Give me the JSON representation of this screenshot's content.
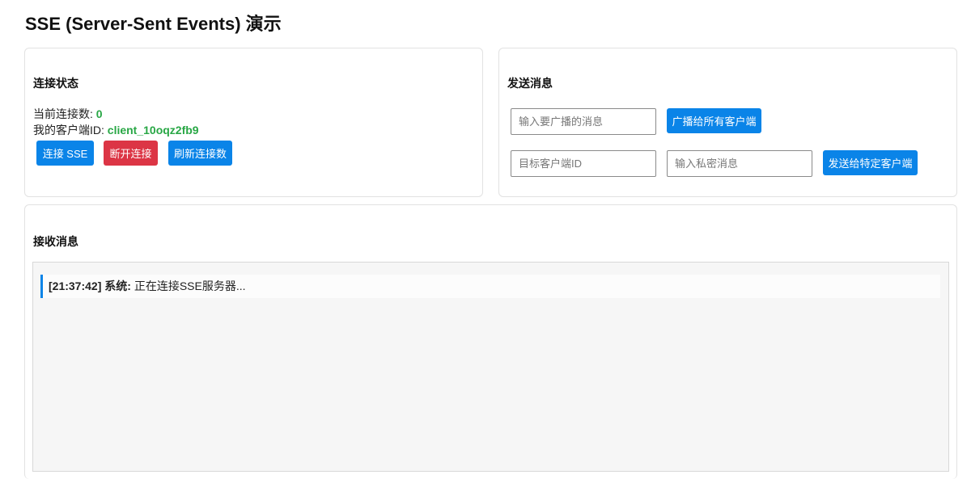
{
  "page": {
    "title": "SSE (Server-Sent Events) 演示"
  },
  "connection": {
    "heading": "连接状态",
    "count_label": "当前连接数: ",
    "count_value": "0",
    "client_label": "我的客户端ID: ",
    "client_value": "client_10oqz2fb9",
    "connect_label": "连接 SSE",
    "disconnect_label": "断开连接",
    "refresh_label": "刷新连接数"
  },
  "send": {
    "heading": "发送消息",
    "broadcast_placeholder": "输入要广播的消息",
    "broadcast_label": "广播给所有客户端",
    "target_placeholder": "目标客户端ID",
    "private_placeholder": "输入私密消息",
    "private_label": "发送给特定客户端"
  },
  "receive": {
    "heading": "接收消息",
    "messages": [
      {
        "time": "[21:37:42]",
        "sender": "系统:",
        "text": "正在连接SSE服务器..."
      }
    ]
  },
  "colors": {
    "primary": "#0a84e8",
    "danger": "#dc3545",
    "success": "#28a745"
  }
}
